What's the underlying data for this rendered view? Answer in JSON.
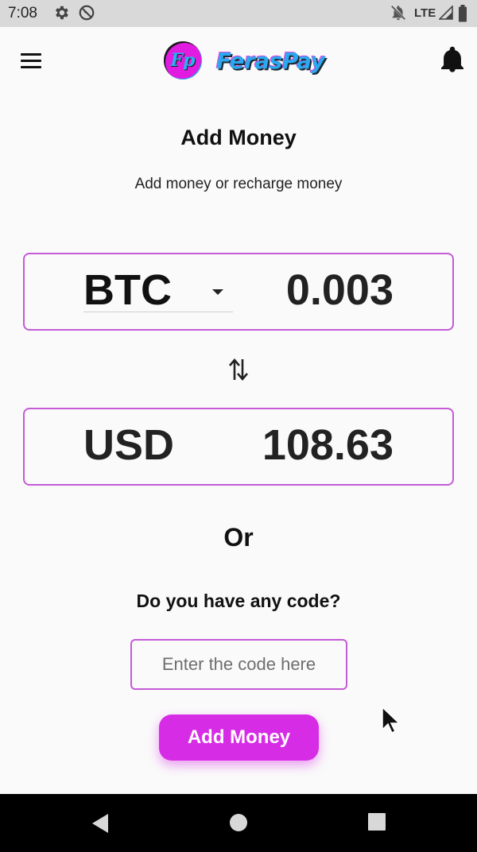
{
  "status_bar": {
    "time": "7:08",
    "network": "LTE",
    "icons": [
      "settings-icon",
      "do-not-disturb-icon",
      "notifications-off-icon",
      "signal-icon",
      "battery-icon"
    ]
  },
  "app_bar": {
    "logo_initials": "Fp",
    "app_name": "FerasPay",
    "icons": [
      "menu-icon",
      "bell-icon"
    ]
  },
  "page": {
    "title": "Add Money",
    "subtitle": "Add money or recharge money"
  },
  "converter": {
    "from": {
      "currency": "BTC",
      "amount": "0.003"
    },
    "to": {
      "currency": "USD",
      "amount": "108.63"
    },
    "swap_icon": "swap-vertical-icon"
  },
  "alternative": {
    "or_text": "Or",
    "code_question": "Do you have any code?",
    "code_placeholder": "Enter the code here",
    "code_value": ""
  },
  "actions": {
    "add_money_label": "Add Money"
  },
  "nav_bar": {
    "icons": [
      "back-icon",
      "home-icon",
      "recents-icon"
    ]
  },
  "colors": {
    "accent": "#d72ce6",
    "border": "#c45bd7",
    "logo_blue": "#2aa9ee"
  }
}
